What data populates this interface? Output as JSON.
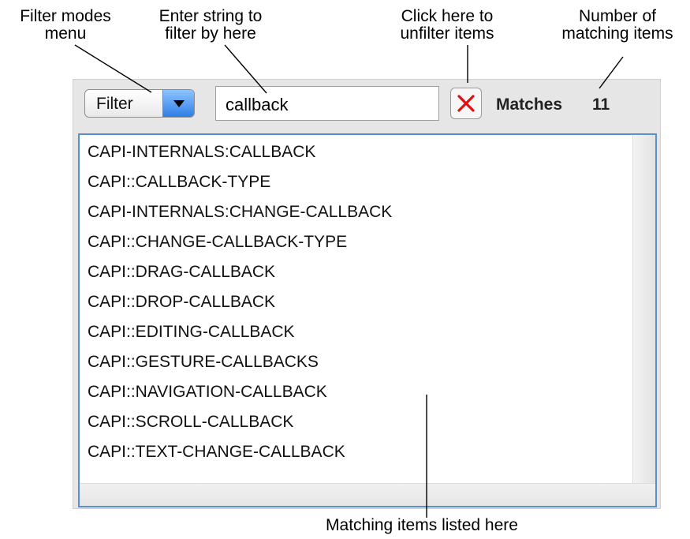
{
  "annotations": {
    "filter_modes": "Filter modes\nmenu",
    "enter_string": "Enter string to\nfilter by here",
    "unfilter": "Click here to\nunfilter items",
    "matching_count": "Number of\nmatching items",
    "matching_listed": "Matching items listed here"
  },
  "toolbar": {
    "filter_label": "Filter",
    "search_value": "callback",
    "matches_label": "Matches",
    "matches_count": "11"
  },
  "list": {
    "items": [
      "CAPI-INTERNALS:CALLBACK",
      "CAPI::CALLBACK-TYPE",
      "CAPI-INTERNALS:CHANGE-CALLBACK",
      "CAPI::CHANGE-CALLBACK-TYPE",
      "CAPI::DRAG-CALLBACK",
      "CAPI::DROP-CALLBACK",
      "CAPI::EDITING-CALLBACK",
      "CAPI::GESTURE-CALLBACKS",
      "CAPI::NAVIGATION-CALLBACK",
      "CAPI::SCROLL-CALLBACK",
      "CAPI::TEXT-CHANGE-CALLBACK"
    ]
  },
  "colors": {
    "accent": "#2f7ee6",
    "list_border": "#5b8fd1",
    "clear_icon": "#e01010"
  },
  "icons": {
    "dropdown": "chevron-down-icon",
    "clear": "close-icon"
  }
}
